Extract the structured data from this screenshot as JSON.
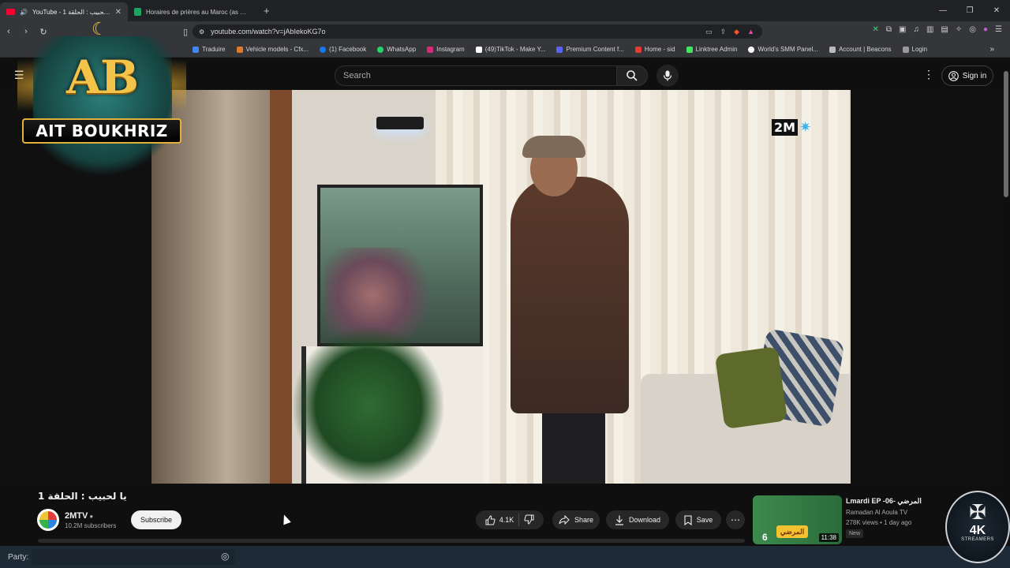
{
  "browser": {
    "tabs": [
      {
        "title": "YouTube - 1 يا لحبيب : الحلقة",
        "active": true,
        "icon": "youtube-icon"
      },
      {
        "title": "Horaires de prières au Maroc (as sobh...",
        "active": false,
        "icon": "sheets-icon"
      }
    ],
    "url": "youtube.com/watch?v=jAbIekoKG7o",
    "bookmarks": [
      {
        "label": "Traduire",
        "color": "#4285f4"
      },
      {
        "label": "Vehicle models - Cfx...",
        "color": "#e07b2a"
      },
      {
        "label": "(1) Facebook",
        "color": "#1877f2"
      },
      {
        "label": "WhatsApp",
        "color": "#25d366"
      },
      {
        "label": "Instagram",
        "color": "#d62976"
      },
      {
        "label": "(49)TikTok - Make Y...",
        "color": "#ffffff"
      },
      {
        "label": "Premium Content f...",
        "color": "#5865f2"
      },
      {
        "label": "Home - sid",
        "color": "#e53935"
      },
      {
        "label": "Linktree Admin",
        "color": "#43e660"
      },
      {
        "label": "World's SMM Panel...",
        "color": "#ffffff"
      },
      {
        "label": "Account | Beacons",
        "color": "#bbbbbb"
      },
      {
        "label": "Login",
        "color": "#999999"
      }
    ]
  },
  "youtube": {
    "search_placeholder": "Search",
    "signin_label": "Sign in",
    "video": {
      "title": "يا لحبيب : الحلقة 1",
      "channel": "2MTV",
      "subscribers": "10.2M subscribers",
      "subscribe_label": "Subscribe",
      "likes": "4.1K",
      "share_label": "Share",
      "download_label": "Download",
      "save_label": "Save",
      "overlay_logo": "2M"
    },
    "recommended": {
      "title": "Lmardi EP -06- المرضي",
      "channel": "Ramadan Al Aoula TV",
      "meta": "278K views • 1 day ago",
      "badge": "New",
      "duration": "11:38",
      "thumb_episode": "6",
      "thumb_text": "المرضي"
    }
  },
  "overlays": {
    "streamer_logo_letters": "AB",
    "streamer_name": "AIT BOUKHRIZ",
    "party_label": "Party:",
    "team_badge_big": "4K",
    "team_badge_small": "STREAMERS"
  },
  "colors": {
    "yt_red": "#ff0033",
    "accent_gold": "#f4c44a",
    "party_bar": "#1e2a36"
  }
}
